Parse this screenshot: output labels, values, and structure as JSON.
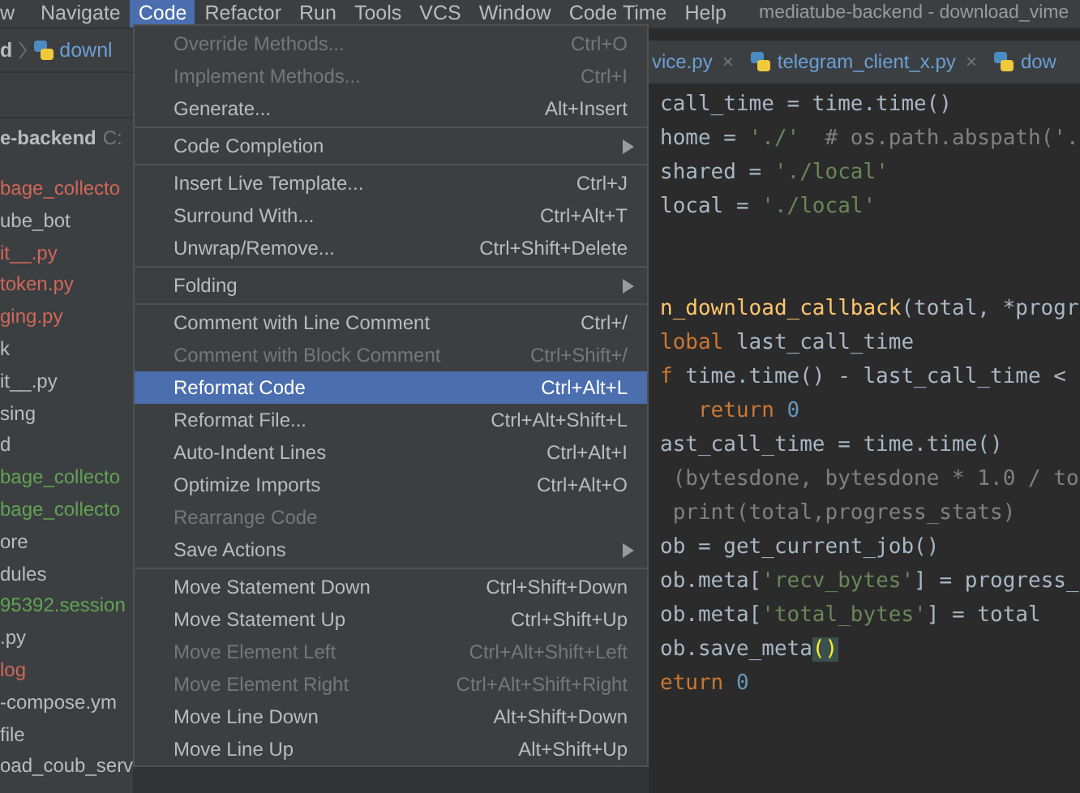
{
  "menubar": {
    "items": [
      {
        "label": "w",
        "selected": false
      },
      {
        "label": "Navigate",
        "selected": false
      },
      {
        "label": "Code",
        "selected": true
      },
      {
        "label": "Refactor",
        "selected": false
      },
      {
        "label": "Run",
        "selected": false
      },
      {
        "label": "Tools",
        "selected": false
      },
      {
        "label": "VCS",
        "selected": false
      },
      {
        "label": "Window",
        "selected": false
      },
      {
        "label": "Code Time",
        "selected": false
      },
      {
        "label": "Help",
        "selected": false
      }
    ],
    "title": "mediatube-backend - download_vime"
  },
  "breadcrumb": {
    "folder": "d",
    "file": "downl"
  },
  "project_tree": {
    "header": {
      "name": "e-backend",
      "path": "C:"
    },
    "items": [
      {
        "label": "bage_collecto",
        "color": "#d1675a"
      },
      {
        "label": "ube_bot",
        "color": "#bbbbbb"
      },
      {
        "label": "it__.py",
        "color": "#d1675a"
      },
      {
        "label": "token.py",
        "color": "#d1675a"
      },
      {
        "label": "ging.py",
        "color": "#d1675a"
      },
      {
        "label": "k",
        "color": "#bbbbbb"
      },
      {
        "label": "it__.py",
        "color": "#bbbbbb"
      },
      {
        "label": "sing",
        "color": "#bbbbbb"
      },
      {
        "label": "d",
        "color": "#bbbbbb"
      },
      {
        "label": "bage_collecto",
        "color": "#62a354"
      },
      {
        "label": "bage_collecto",
        "color": "#62a354"
      },
      {
        "label": "ore",
        "color": "#bbbbbb"
      },
      {
        "label": "dules",
        "color": "#bbbbbb"
      },
      {
        "label": "95392.session",
        "color": "#62a354"
      },
      {
        "label": ".py",
        "color": "#bbbbbb"
      },
      {
        "label": "log",
        "color": "#d1675a"
      },
      {
        "label": "-compose.ym",
        "color": "#bbbbbb"
      },
      {
        "label": "file",
        "color": "#bbbbbb"
      },
      {
        "label": "oad_coub_serv",
        "color": "#bbbbbb"
      }
    ]
  },
  "editor": {
    "tabs": [
      {
        "label": "vice.py",
        "close": "×"
      },
      {
        "label": "telegram_client_x.py",
        "close": "×"
      },
      {
        "label": "dow"
      }
    ],
    "lines": [
      {
        "tokens": [
          {
            "text": "call_time = time.time()",
            "kind": "plain"
          }
        ]
      },
      {
        "tokens": [
          {
            "text": "home = ",
            "kind": "plain"
          },
          {
            "text": "'./'",
            "kind": "string"
          },
          {
            "text": "  # os.path.abspath('.",
            "kind": "comment"
          }
        ]
      },
      {
        "tokens": [
          {
            "text": "shared = ",
            "kind": "plain"
          },
          {
            "text": "'./local'",
            "kind": "string"
          }
        ]
      },
      {
        "tokens": [
          {
            "text": "local = ",
            "kind": "plain"
          },
          {
            "text": "'./local'",
            "kind": "string"
          }
        ]
      },
      {
        "kind": "blank"
      },
      {
        "kind": "blank"
      },
      {
        "tokens": [
          {
            "text": "n_download_callback",
            "kind": "function"
          },
          {
            "text": "(total, *progr",
            "kind": "plain"
          }
        ]
      },
      {
        "tokens": [
          {
            "text": "lobal",
            "kind": "keyword"
          },
          {
            "text": " last_call_time",
            "kind": "plain"
          }
        ]
      },
      {
        "tokens": [
          {
            "text": "f",
            "kind": "keyword"
          },
          {
            "text": " time.time() - last_call_time <",
            "kind": "plain"
          }
        ]
      },
      {
        "tokens": [
          {
            "text": "   return",
            "kind": "keyword"
          },
          {
            "text": " 0",
            "kind": "number"
          }
        ]
      },
      {
        "tokens": [
          {
            "text": "ast_call_time = time.time()",
            "kind": "plain"
          }
        ]
      },
      {
        "tokens": [
          {
            "text": " (bytesdone, bytesdone * 1.0 / to",
            "kind": "comment"
          }
        ]
      },
      {
        "tokens": [
          {
            "text": " print(total,progress_stats)",
            "kind": "comment"
          }
        ]
      },
      {
        "tokens": [
          {
            "text": "ob = get_current_job()",
            "kind": "plain"
          }
        ]
      },
      {
        "tokens": [
          {
            "text": "ob.meta[",
            "kind": "plain"
          },
          {
            "text": "'recv_bytes'",
            "kind": "string"
          },
          {
            "text": "] = progress_",
            "kind": "plain"
          }
        ]
      },
      {
        "tokens": [
          {
            "text": "ob.meta[",
            "kind": "plain"
          },
          {
            "text": "'total_bytes'",
            "kind": "string"
          },
          {
            "text": "] = total",
            "kind": "plain"
          }
        ]
      },
      {
        "tokens": [
          {
            "text": "ob.save_meta",
            "kind": "plain"
          },
          {
            "text": "()",
            "kind": "bracket-match"
          }
        ]
      },
      {
        "tokens": [
          {
            "text": "eturn",
            "kind": "keyword"
          },
          {
            "text": " 0",
            "kind": "number"
          }
        ]
      }
    ]
  },
  "code_menu": {
    "groups": [
      [
        {
          "label": "Override Methods...",
          "shortcut": "Ctrl+O",
          "disabled": true,
          "selected": false,
          "submenu": false
        },
        {
          "label": "Implement Methods...",
          "shortcut": "Ctrl+I",
          "disabled": true,
          "selected": false,
          "submenu": false
        },
        {
          "label": "Generate...",
          "shortcut": "Alt+Insert",
          "disabled": false,
          "selected": false,
          "submenu": false
        }
      ],
      [
        {
          "label": "Code Completion",
          "disabled": false,
          "selected": false,
          "submenu": true
        }
      ],
      [
        {
          "label": "Insert Live Template...",
          "shortcut": "Ctrl+J",
          "disabled": false,
          "selected": false,
          "submenu": false
        },
        {
          "label": "Surround With...",
          "shortcut": "Ctrl+Alt+T",
          "disabled": false,
          "selected": false,
          "submenu": false
        },
        {
          "label": "Unwrap/Remove...",
          "shortcut": "Ctrl+Shift+Delete",
          "disabled": false,
          "selected": false,
          "submenu": false
        }
      ],
      [
        {
          "label": "Folding",
          "disabled": false,
          "selected": false,
          "submenu": true
        }
      ],
      [
        {
          "label": "Comment with Line Comment",
          "shortcut": "Ctrl+/",
          "disabled": false,
          "selected": false,
          "submenu": false
        },
        {
          "label": "Comment with Block Comment",
          "shortcut": "Ctrl+Shift+/",
          "disabled": true,
          "selected": false,
          "submenu": false
        },
        {
          "label": "Reformat Code",
          "shortcut": "Ctrl+Alt+L",
          "disabled": false,
          "selected": true,
          "submenu": false
        },
        {
          "label": "Reformat File...",
          "shortcut": "Ctrl+Alt+Shift+L",
          "disabled": false,
          "selected": false,
          "submenu": false
        },
        {
          "label": "Auto-Indent Lines",
          "shortcut": "Ctrl+Alt+I",
          "disabled": false,
          "selected": false,
          "submenu": false
        },
        {
          "label": "Optimize Imports",
          "shortcut": "Ctrl+Alt+O",
          "disabled": false,
          "selected": false,
          "submenu": false
        },
        {
          "label": "Rearrange Code",
          "disabled": true,
          "selected": false,
          "submenu": false
        },
        {
          "label": "Save Actions",
          "disabled": false,
          "selected": false,
          "submenu": true
        }
      ],
      [
        {
          "label": "Move Statement Down",
          "shortcut": "Ctrl+Shift+Down",
          "disabled": false,
          "selected": false,
          "submenu": false
        },
        {
          "label": "Move Statement Up",
          "shortcut": "Ctrl+Shift+Up",
          "disabled": false,
          "selected": false,
          "submenu": false
        },
        {
          "label": "Move Element Left",
          "shortcut": "Ctrl+Alt+Shift+Left",
          "disabled": true,
          "selected": false,
          "submenu": false
        },
        {
          "label": "Move Element Right",
          "shortcut": "Ctrl+Alt+Shift+Right",
          "disabled": true,
          "selected": false,
          "submenu": false
        },
        {
          "label": "Move Line Down",
          "shortcut": "Alt+Shift+Down",
          "disabled": false,
          "selected": false,
          "submenu": false
        },
        {
          "label": "Move Line Up",
          "shortcut": "Alt+Shift+Up",
          "disabled": false,
          "selected": false,
          "submenu": false
        }
      ]
    ]
  }
}
